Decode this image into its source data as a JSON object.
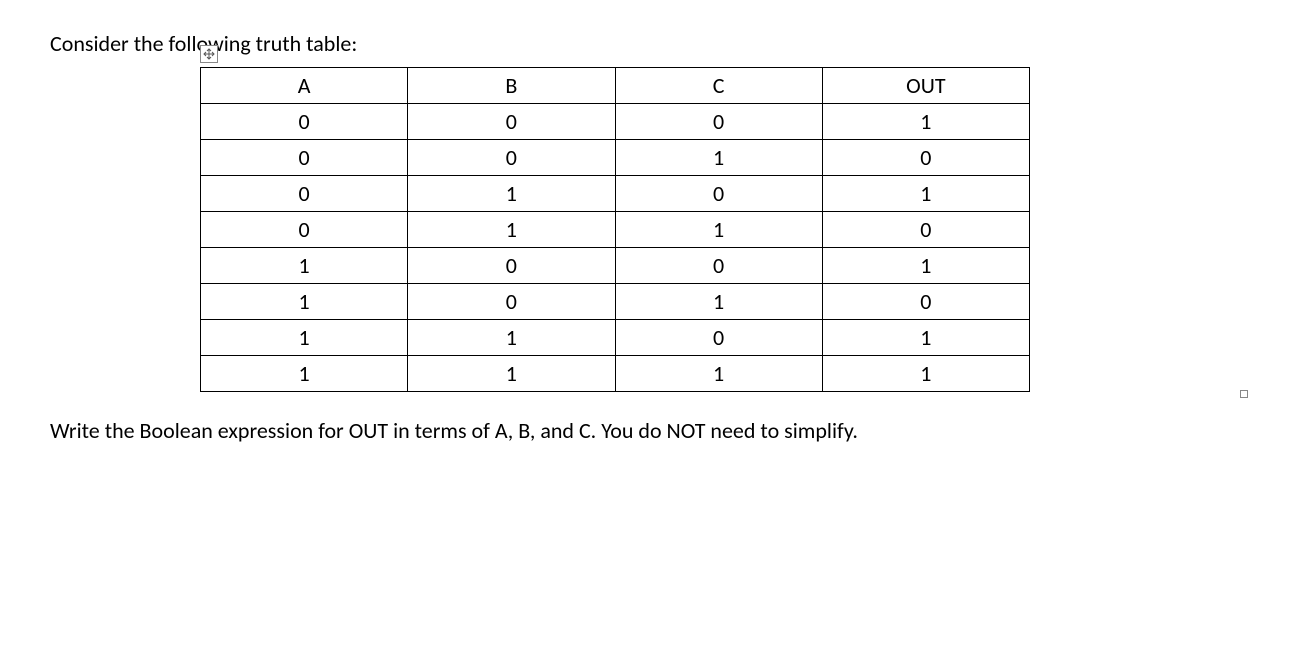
{
  "intro": "Consider the following truth table:",
  "table": {
    "headers": [
      "A",
      "B",
      "C",
      "OUT"
    ],
    "rows": [
      [
        "0",
        "0",
        "0",
        "1"
      ],
      [
        "0",
        "0",
        "1",
        "0"
      ],
      [
        "0",
        "1",
        "0",
        "1"
      ],
      [
        "0",
        "1",
        "1",
        "0"
      ],
      [
        "1",
        "0",
        "0",
        "1"
      ],
      [
        "1",
        "0",
        "1",
        "0"
      ],
      [
        "1",
        "1",
        "0",
        "1"
      ],
      [
        "1",
        "1",
        "1",
        "1"
      ]
    ]
  },
  "conclusion": "Write the Boolean expression for OUT in terms of A, B, and C. You do NOT need to simplify."
}
